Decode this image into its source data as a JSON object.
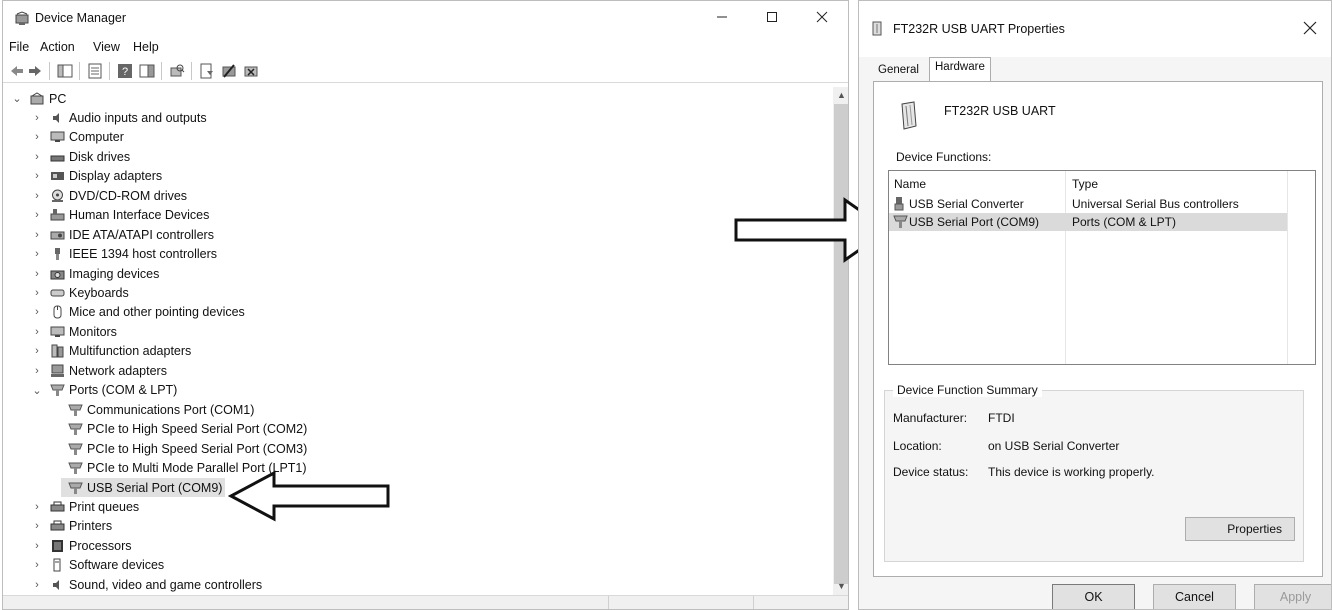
{
  "device_manager": {
    "title": "Device Manager",
    "menu": [
      "File",
      "Action",
      "View",
      "Help"
    ],
    "tree": [
      {
        "label": "PC",
        "icon": "pc-icon",
        "expanded": true
      },
      {
        "label": "Audio inputs and outputs",
        "icon": "speaker-icon"
      },
      {
        "label": "Computer",
        "icon": "monitor-icon"
      },
      {
        "label": "Disk drives",
        "icon": "disk-icon"
      },
      {
        "label": "Display adapters",
        "icon": "display-adapter-icon"
      },
      {
        "label": "DVD/CD-ROM drives",
        "icon": "dvd-icon"
      },
      {
        "label": "Human Interface Devices",
        "icon": "hid-icon"
      },
      {
        "label": "IDE ATA/ATAPI controllers",
        "icon": "ide-icon"
      },
      {
        "label": "IEEE 1394 host controllers",
        "icon": "ieee1394-icon"
      },
      {
        "label": "Imaging devices",
        "icon": "camera-icon"
      },
      {
        "label": "Keyboards",
        "icon": "keyboard-icon"
      },
      {
        "label": "Mice and other pointing devices",
        "icon": "mouse-icon"
      },
      {
        "label": "Monitors",
        "icon": "monitor-icon"
      },
      {
        "label": "Multifunction adapters",
        "icon": "multifunction-icon"
      },
      {
        "label": "Network adapters",
        "icon": "network-icon"
      },
      {
        "label": "Ports (COM & LPT)",
        "icon": "port-icon",
        "expanded": true
      },
      {
        "label": "Communications Port (COM1)",
        "icon": "port-icon",
        "child": true
      },
      {
        "label": "PCIe to High Speed Serial Port (COM2)",
        "icon": "port-icon",
        "child": true
      },
      {
        "label": "PCIe to High Speed Serial Port (COM3)",
        "icon": "port-icon",
        "child": true
      },
      {
        "label": "PCIe to Multi Mode Parallel Port (LPT1)",
        "icon": "port-icon",
        "child": true
      },
      {
        "label": "USB Serial Port (COM9)",
        "icon": "port-icon",
        "child": true,
        "selected": true
      },
      {
        "label": "Print queues",
        "icon": "printer-icon"
      },
      {
        "label": "Printers",
        "icon": "printer-icon"
      },
      {
        "label": "Processors",
        "icon": "processor-icon"
      },
      {
        "label": "Software devices",
        "icon": "software-icon"
      },
      {
        "label": "Sound, video and game controllers",
        "icon": "speaker-icon"
      }
    ]
  },
  "properties": {
    "title": "FT232R USB UART Properties",
    "tabs": [
      "General",
      "Hardware"
    ],
    "active_tab": "Hardware",
    "device_name": "FT232R USB UART",
    "functions_label": "Device Functions:",
    "columns": [
      "Name",
      "Type"
    ],
    "functions": [
      {
        "name": "USB Serial Converter",
        "type": "Universal Serial Bus controllers",
        "icon": "usb-plug-icon"
      },
      {
        "name": "USB Serial Port (COM9)",
        "type": "Ports (COM & LPT)",
        "icon": "port-icon",
        "selected": true
      }
    ],
    "summary": {
      "legend": "Device Function Summary",
      "manufacturer_label": "Manufacturer:",
      "manufacturer": "FTDI",
      "location_label": "Location:",
      "location": "on USB Serial Converter",
      "status_label": "Device status:",
      "status": "This device is working properly."
    },
    "properties_button": "Properties",
    "ok": "OK",
    "cancel": "Cancel",
    "apply": "Apply"
  }
}
